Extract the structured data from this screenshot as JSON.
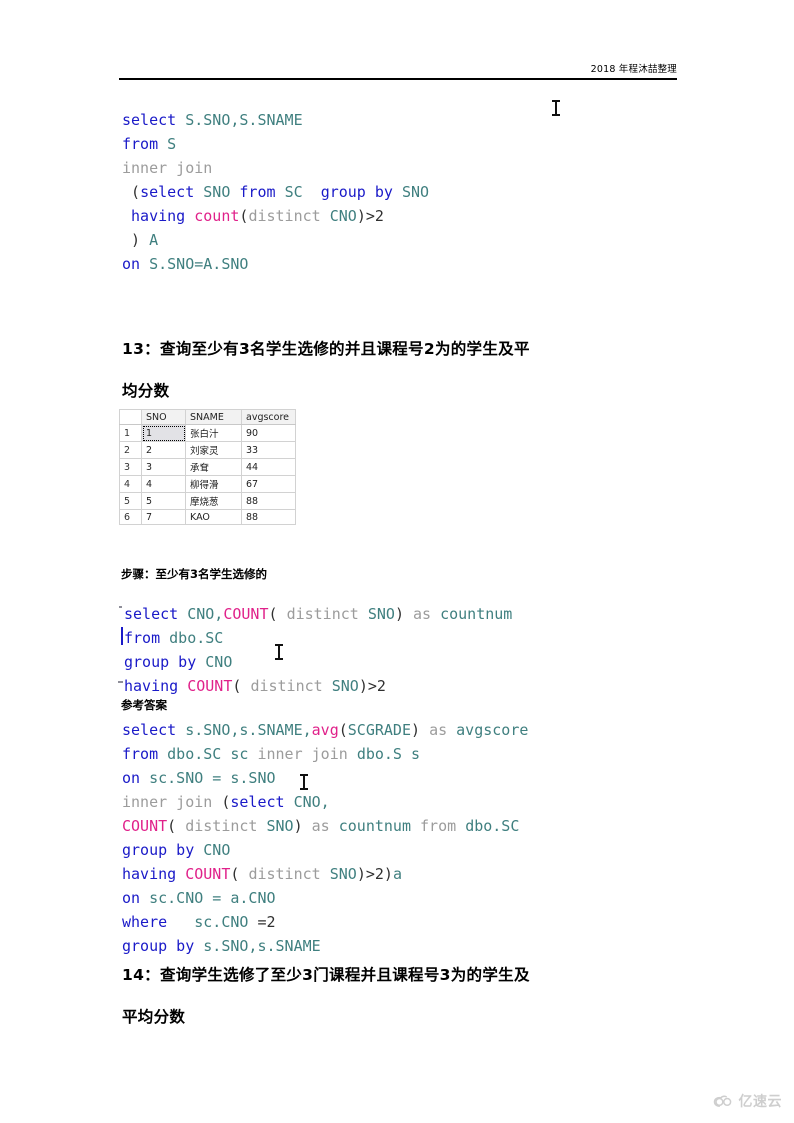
{
  "page": {
    "header_text": "2018 年程沐喆整理",
    "watermark_text": "亿速云",
    "watermark_icon": "cloud-icon"
  },
  "code_block_1": {
    "name": "sql-query-12",
    "lines": [
      [
        {
          "t": "select",
          "c": "kw"
        },
        {
          "t": " ",
          "c": "pun"
        },
        {
          "t": "S.SNO,S.SNAME",
          "c": "id"
        }
      ],
      [
        {
          "t": "from",
          "c": "kw"
        },
        {
          "t": " ",
          "c": "pun"
        },
        {
          "t": "S",
          "c": "id"
        }
      ],
      [
        {
          "t": "inner join",
          "c": "gray"
        }
      ],
      [
        {
          "t": " (",
          "c": "pun"
        },
        {
          "t": "select",
          "c": "kw"
        },
        {
          "t": " ",
          "c": "pun"
        },
        {
          "t": "SNO",
          "c": "id"
        },
        {
          "t": " ",
          "c": "pun"
        },
        {
          "t": "from",
          "c": "kw"
        },
        {
          "t": " ",
          "c": "pun"
        },
        {
          "t": "SC",
          "c": "id"
        },
        {
          "t": "  ",
          "c": "pun"
        },
        {
          "t": "group by",
          "c": "kw"
        },
        {
          "t": " ",
          "c": "pun"
        },
        {
          "t": "SNO",
          "c": "id"
        }
      ],
      [
        {
          "t": " ",
          "c": "pun"
        },
        {
          "t": "having",
          "c": "kw"
        },
        {
          "t": " ",
          "c": "pun"
        },
        {
          "t": "count",
          "c": "fn"
        },
        {
          "t": "(",
          "c": "pun"
        },
        {
          "t": "distinct",
          "c": "gray"
        },
        {
          "t": " ",
          "c": "pun"
        },
        {
          "t": "CNO",
          "c": "id"
        },
        {
          "t": ")>2",
          "c": "pun"
        }
      ],
      [
        {
          "t": " ) ",
          "c": "pun"
        },
        {
          "t": "A",
          "c": "id"
        }
      ],
      [
        {
          "t": "on",
          "c": "kw"
        },
        {
          "t": " ",
          "c": "pun"
        },
        {
          "t": "S.SNO=A.SNO",
          "c": "id"
        }
      ]
    ]
  },
  "section_13": {
    "line1": "13：查询至少有3名学生选修的并且课程号2为的学生及平",
    "line2": "均分数"
  },
  "result_grid": {
    "name": "query-result-grid",
    "columns": [
      "",
      "SNO",
      "SNAME",
      "avgscore"
    ],
    "rows": [
      {
        "n": "1",
        "sno": "1",
        "sname": "张白汁",
        "avgscore": "90",
        "selected": true
      },
      {
        "n": "2",
        "sno": "2",
        "sname": "刘家灵",
        "avgscore": "33",
        "selected": false
      },
      {
        "n": "3",
        "sno": "3",
        "sname": "承耷",
        "avgscore": "44",
        "selected": false
      },
      {
        "n": "4",
        "sno": "4",
        "sname": "柳得滑",
        "avgscore": "67",
        "selected": false
      },
      {
        "n": "5",
        "sno": "5",
        "sname": "摩烧葱",
        "avgscore": "88",
        "selected": false
      },
      {
        "n": "6",
        "sno": "7",
        "sname": "KAO",
        "avgscore": "88",
        "selected": false
      }
    ]
  },
  "step_label": "步骤：至少有3名学生选修的",
  "code_block_2": {
    "name": "sql-step-query",
    "lines": [
      [
        {
          "t": "select",
          "c": "kw"
        },
        {
          "t": " ",
          "c": "pun"
        },
        {
          "t": "CNO,",
          "c": "id"
        },
        {
          "t": "COUNT",
          "c": "fn"
        },
        {
          "t": "( ",
          "c": "pun"
        },
        {
          "t": "distinct",
          "c": "gray"
        },
        {
          "t": " ",
          "c": "pun"
        },
        {
          "t": "SNO",
          "c": "id"
        },
        {
          "t": ") ",
          "c": "pun"
        },
        {
          "t": "as",
          "c": "gray"
        },
        {
          "t": " ",
          "c": "pun"
        },
        {
          "t": "countnum",
          "c": "id"
        }
      ],
      [
        {
          "t": "from",
          "c": "kw"
        },
        {
          "t": " ",
          "c": "pun"
        },
        {
          "t": "dbo.SC",
          "c": "id"
        }
      ],
      [
        {
          "t": "group by",
          "c": "kw"
        },
        {
          "t": " ",
          "c": "pun"
        },
        {
          "t": "CNO",
          "c": "id"
        }
      ],
      [
        {
          "t": "having",
          "c": "kw"
        },
        {
          "t": " ",
          "c": "pun"
        },
        {
          "t": "COUNT",
          "c": "fn"
        },
        {
          "t": "( ",
          "c": "pun"
        },
        {
          "t": "distinct",
          "c": "gray"
        },
        {
          "t": " ",
          "c": "pun"
        },
        {
          "t": "SNO",
          "c": "id"
        },
        {
          "t": ")>2",
          "c": "pun"
        }
      ]
    ]
  },
  "answer_label": "参考答案",
  "code_block_3": {
    "name": "sql-reference-answer",
    "lines": [
      [
        {
          "t": "select",
          "c": "kw"
        },
        {
          "t": " ",
          "c": "pun"
        },
        {
          "t": "s.SNO,s.SNAME,",
          "c": "id"
        },
        {
          "t": "avg",
          "c": "fn"
        },
        {
          "t": "(",
          "c": "pun"
        },
        {
          "t": "SCGRADE",
          "c": "id"
        },
        {
          "t": ") ",
          "c": "pun"
        },
        {
          "t": "as",
          "c": "gray"
        },
        {
          "t": " ",
          "c": "pun"
        },
        {
          "t": "avgscore",
          "c": "id"
        }
      ],
      [
        {
          "t": "from",
          "c": "kw"
        },
        {
          "t": " ",
          "c": "pun"
        },
        {
          "t": "dbo.SC sc",
          "c": "id"
        },
        {
          "t": " ",
          "c": "pun"
        },
        {
          "t": "inner join",
          "c": "gray"
        },
        {
          "t": " ",
          "c": "pun"
        },
        {
          "t": "dbo.S s",
          "c": "id"
        }
      ],
      [
        {
          "t": "on",
          "c": "kw"
        },
        {
          "t": " ",
          "c": "pun"
        },
        {
          "t": "sc.SNO = s.SNO",
          "c": "id"
        }
      ],
      [
        {
          "t": "inner join",
          "c": "gray"
        },
        {
          "t": " (",
          "c": "pun"
        },
        {
          "t": "select",
          "c": "kw"
        },
        {
          "t": " ",
          "c": "pun"
        },
        {
          "t": "CNO,",
          "c": "id"
        }
      ],
      [
        {
          "t": "COUNT",
          "c": "fn"
        },
        {
          "t": "( ",
          "c": "pun"
        },
        {
          "t": "distinct",
          "c": "gray"
        },
        {
          "t": " ",
          "c": "pun"
        },
        {
          "t": "SNO",
          "c": "id"
        },
        {
          "t": ") ",
          "c": "pun"
        },
        {
          "t": "as",
          "c": "gray"
        },
        {
          "t": " ",
          "c": "pun"
        },
        {
          "t": "countnum",
          "c": "id"
        },
        {
          "t": " ",
          "c": "pun"
        },
        {
          "t": "from",
          "c": "gray"
        },
        {
          "t": " ",
          "c": "pun"
        },
        {
          "t": "dbo.SC",
          "c": "id"
        }
      ],
      [
        {
          "t": "group by",
          "c": "kw"
        },
        {
          "t": " ",
          "c": "pun"
        },
        {
          "t": "CNO",
          "c": "id"
        }
      ],
      [
        {
          "t": "having",
          "c": "kw"
        },
        {
          "t": " ",
          "c": "pun"
        },
        {
          "t": "COUNT",
          "c": "fn"
        },
        {
          "t": "( ",
          "c": "pun"
        },
        {
          "t": "distinct",
          "c": "gray"
        },
        {
          "t": " ",
          "c": "pun"
        },
        {
          "t": "SNO",
          "c": "id"
        },
        {
          "t": ")>2)",
          "c": "pun"
        },
        {
          "t": "a",
          "c": "id"
        }
      ],
      [
        {
          "t": "on",
          "c": "kw"
        },
        {
          "t": " ",
          "c": "pun"
        },
        {
          "t": "sc.CNO = a.CNO",
          "c": "id"
        }
      ],
      [
        {
          "t": "where",
          "c": "kw"
        },
        {
          "t": "   ",
          "c": "pun"
        },
        {
          "t": "sc.CNO",
          "c": "id"
        },
        {
          "t": " =2",
          "c": "pun"
        }
      ],
      [
        {
          "t": "group by",
          "c": "kw"
        },
        {
          "t": " ",
          "c": "pun"
        },
        {
          "t": "s.SNO,s.SNAME",
          "c": "id"
        }
      ]
    ]
  },
  "section_14": {
    "line1": "14：查询学生选修了至少3门课程并且课程号3为的学生及",
    "line2": "平均分数"
  }
}
